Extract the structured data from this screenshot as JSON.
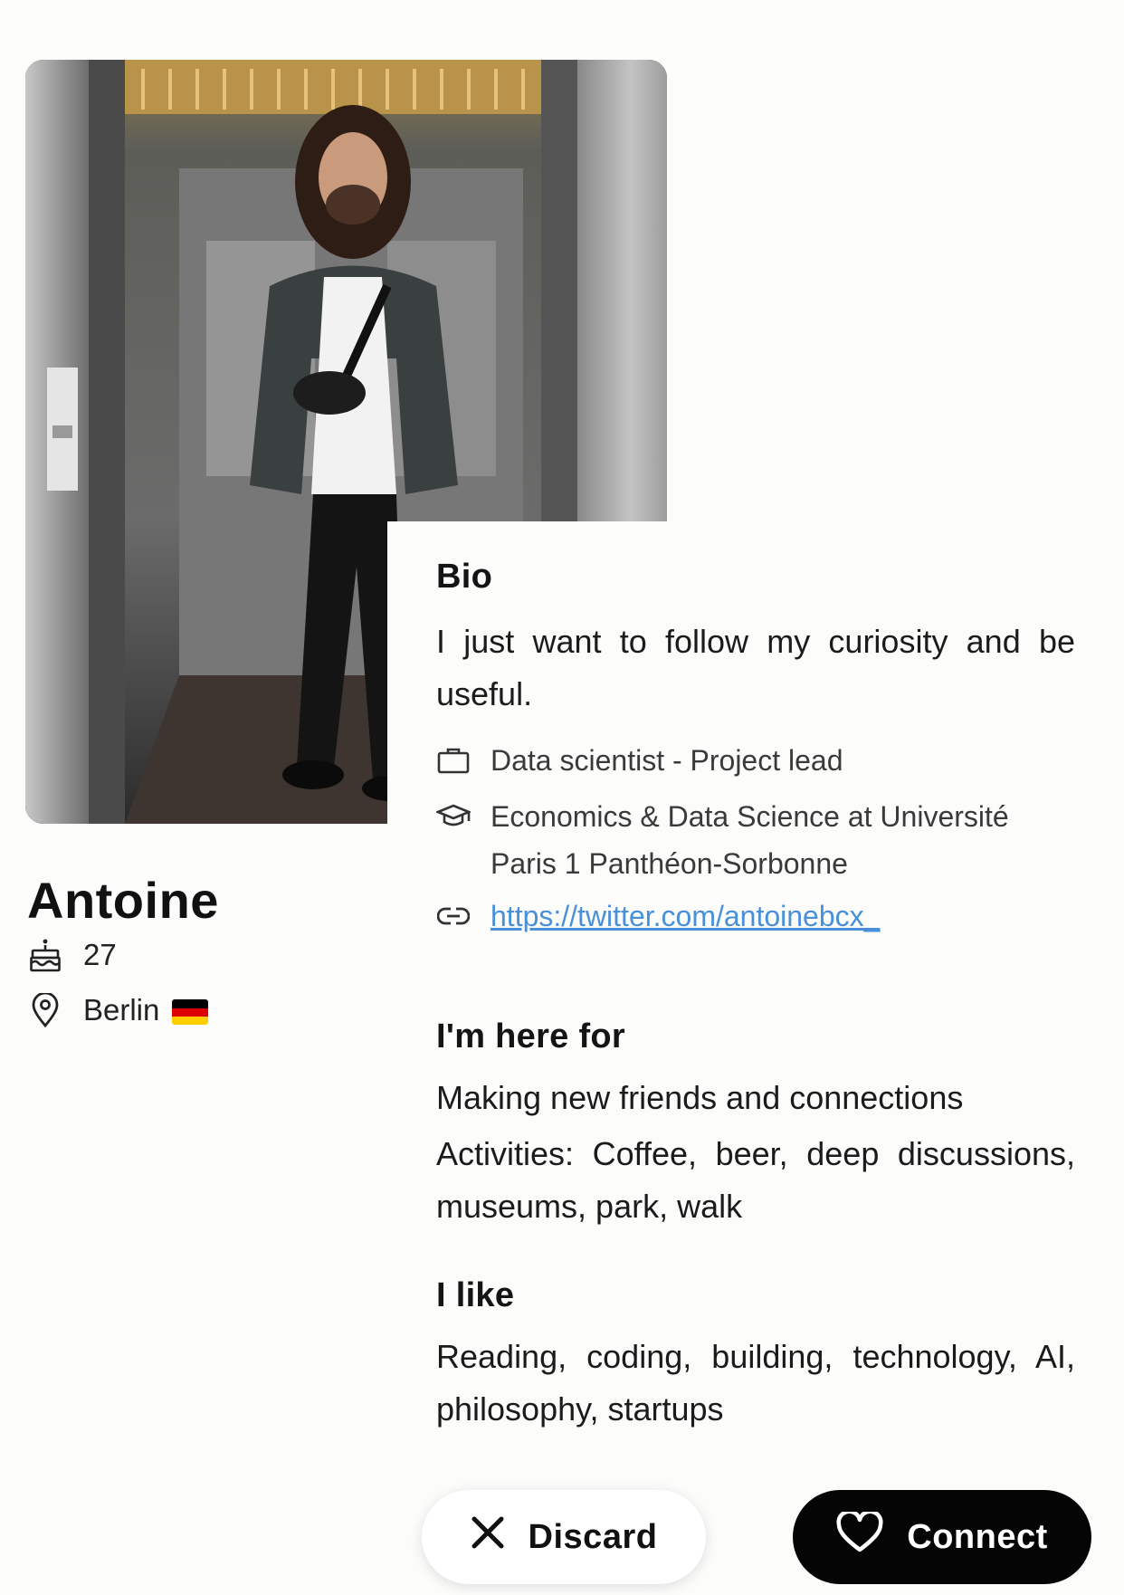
{
  "profile": {
    "name": "Antoine",
    "age": "27",
    "location": "Berlin",
    "flag": "germany-flag",
    "photo_alt": "profile-photo"
  },
  "bio": {
    "title": "Bio",
    "text": "I just want to follow my curiosity and be useful.",
    "job": "Data scientist - Project lead",
    "education": "Economics & Data Science at Université Paris 1 Panthéon-Sorbonne",
    "link": "https://twitter.com/antoinebcx_"
  },
  "here_for": {
    "title": "I'm here for",
    "goal": "Making new friends and connections",
    "activities": "Activities: Coffee, beer, deep discussions, museums, park, walk"
  },
  "likes": {
    "title": "I like",
    "text": "Reading, coding, building, technology, AI, philosophy, startups"
  },
  "actions": {
    "discard_label": "Discard",
    "connect_label": "Connect"
  },
  "icons": {
    "age": "birthday-cake-icon",
    "location": "location-pin-icon",
    "job": "briefcase-icon",
    "education": "graduation-cap-icon",
    "link": "link-icon",
    "discard": "close-icon",
    "connect": "heart-icon"
  },
  "colors": {
    "background": "#fcfcfb",
    "link": "#4a90d9",
    "connect_button": "#050505",
    "discard_button": "#ffffff"
  }
}
